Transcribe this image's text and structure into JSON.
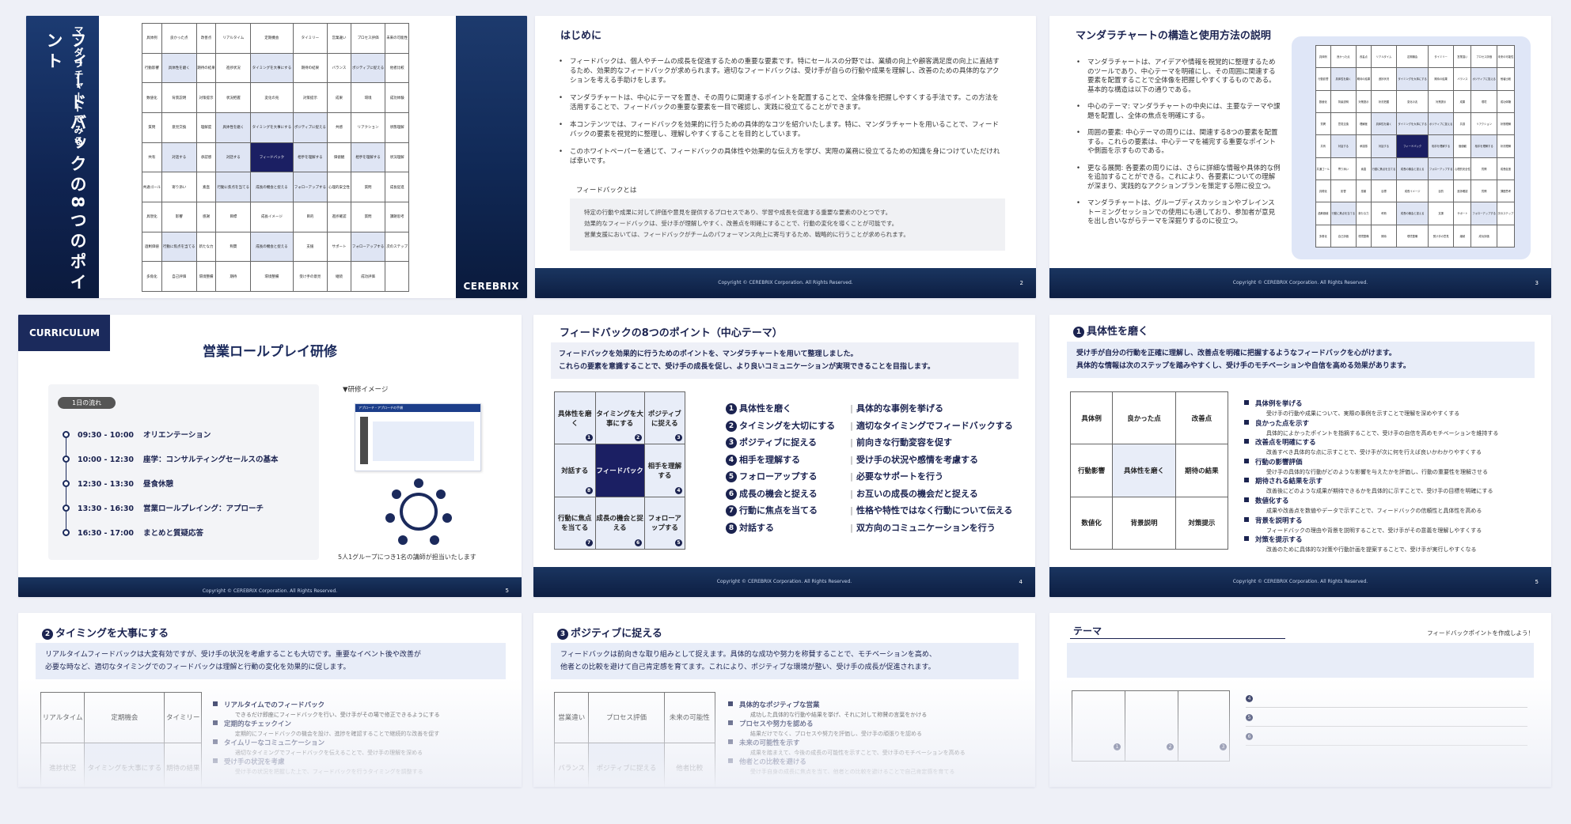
{
  "slide1": {
    "subtitle": "マンダラチャートでみる",
    "title": "フィードバックの8つのポイント",
    "logo": "CEREBRIX",
    "grid": [
      [
        "具体例",
        "良かった点",
        "改善点",
        "リアルタイム",
        "定期機会",
        "タイミリー",
        "営業違い",
        "プロセス評価",
        "未来の可能性"
      ],
      [
        "行動影響",
        "具体性を磨く",
        "期待の結果",
        "進捗状況",
        "タイミングを大事にする",
        "期待の結果",
        "バランス",
        "ポジティブに捉える",
        "他者比較"
      ],
      [
        "数値化",
        "背景説明",
        "対策提示",
        "状況把握",
        "変化の兆",
        "対策提示",
        "成果",
        "環境",
        "成功体験"
      ],
      [
        "質問",
        "意見交換",
        "理解度",
        "具体性を磨く",
        "タイミングを大事にする",
        "ポジティブに捉える",
        "共感",
        "リアクション",
        "状態理解"
      ],
      [
        "共有",
        "対話する",
        "承認感",
        "対話する",
        "フィードバック",
        "相手を理解する",
        "価値観",
        "相手を理解する",
        "状況理解"
      ],
      [
        "共通ゴール",
        "寄り添い",
        "素直",
        "行動に焦点を当てる",
        "成長の機会と捉える",
        "フォローアップする",
        "心理的安全性",
        "質問",
        "成長促進"
      ],
      [
        "具現化",
        "影響",
        "感謝",
        "目標",
        "成長イメージ",
        "目的",
        "進捗確認",
        "質問",
        "課題思考"
      ],
      [
        "過剰価値",
        "行動に焦点を当てる",
        "新たな力",
        "称賛",
        "成長の機会と捉える",
        "支援",
        "サポート",
        "フォローアップする",
        "次のステップ"
      ],
      [
        "多角化",
        "自己評価",
        "環境整備",
        "期待",
        "環境整備",
        "受け手の意見",
        "継続",
        "成功評価",
        ""
      ]
    ]
  },
  "slide2": {
    "title": "はじめに",
    "bullets": [
      "フィードバックは、個人やチームの成長を促進するための重要な要素です。特にセールスの分野では、業績の向上や顧客満足度の向上に直結するため、効果的なフィードバックが求められます。適切なフィードバックは、受け手が自らの行動や成果を理解し、改善のための具体的なアクションを考える手助けをします。",
      "マンダラチャートは、中心にテーマを置き、その周りに関連するポイントを配置することで、全体像を把握しやすくする手法です。この方法を活用することで、フィードバックの重要な要素を一目で確認し、実践に役立てることができます。",
      "本コンテンツでは、フィードバックを効果的に行うための具体的なコツを紹介いたします。特に、マンダラチャートを用いることで、フィードバックの要素を視覚的に整理し、理解しやすくすることを目的としています。",
      "このホワイトペーパーを通じて、フィードバックの具体性や効果的な伝え方を学び、実際の業務に役立てるための知識を身につけていただければ幸いです。"
    ],
    "box_heading": "フィードバックとは",
    "box_lines": [
      "特定の行動や成果に対して評価や意見を提供するプロセスであり、学習や成長を促進する重要な要素のひとつです。",
      "効果的なフィードバックは、受け手が理解しやすく、改善点を明確にすることで、行動の変化を導くことが可能です。",
      "営業支援においては、フィードバックがチームのパフォーマンス向上に寄与するため、戦略的に行うことが求められます。"
    ],
    "copyright": "Copyright © CEREBRIX Corporation. All Rights Reserved.",
    "page": "2"
  },
  "slide3": {
    "title": "マンダラチャートの構造と使用方法の説明",
    "bullets": [
      "マンダラチャートは、アイデアや情報を視覚的に整理するためのツールであり、中心テーマを明確にし、その周囲に関連する要素を配置することで全体像を把握しやすくするものである。基本的な構造は以下の通りである。",
      "中心のテーマ: マンダラチャートの中央には、主要なテーマや課題を配置し、全体の焦点を明確にする。",
      "周囲の要素: 中心テーマの周りには、関連する8つの要素を配置する。これらの要素は、中心テーマを補完する重要なポイントや側面を示すものである。",
      "更なる展開: 各要素の周りには、さらに詳細な情報や具体的な例を追加することができる。これにより、各要素についての理解が深まり、実践的なアクションプランを策定する際に役立つ。",
      "マンダラチャートは、グループディスカッションやブレインストーミングセッションでの使用にも適しており、参加者が意見を出し合いながらテーマを深掘りするのに役立つ。"
    ],
    "copyright": "Copyright © CEREBRIX Corporation. All Rights Reserved.",
    "page": "3"
  },
  "slide4": {
    "badge": "CURRICULUM",
    "title": "営業ロールプレイ研修",
    "flow_label": "1日の流れ",
    "schedule": [
      {
        "time": "09:30 - 10:00",
        "item": "オリエンテーション"
      },
      {
        "time": "10:00 - 12:30",
        "item": "座学：コンサルティングセールスの基本"
      },
      {
        "time": "12:30 - 13:30",
        "item": "昼食休憩"
      },
      {
        "time": "13:30 - 16:30",
        "item": "営業ロールプレイング：アプローチ"
      },
      {
        "time": "16:30 - 17:00",
        "item": "まとめと質疑応答"
      }
    ],
    "image_label": "▼研修イメージ",
    "image_caption": "アプローチ・アプローチの手順",
    "group_note": "5人1グループにつき1名の講師が担当いたします",
    "copyright": "Copyright © CEREBRIX Corporation. All Rights Reserved.",
    "page": "5"
  },
  "slide5": {
    "title": "フィードバックの8つのポイント（中心テーマ）",
    "intro": [
      "フィードバックを効果的に行うためのポイントを、マンダラチャートを用いて整理しました。",
      "これらの要素を意識することで、受け手の成長を促し、より良いコミュニケーションが実現できることを目指します。"
    ],
    "grid": [
      [
        {
          "t": "具体性を磨く",
          "n": "1"
        },
        {
          "t": "タイミングを大事にする",
          "n": "2"
        },
        {
          "t": "ポジティブに捉える",
          "n": "3"
        }
      ],
      [
        {
          "t": "対話する",
          "n": "8"
        },
        {
          "t": "フィードバック",
          "n": ""
        },
        {
          "t": "相手を理解する",
          "n": "4"
        }
      ],
      [
        {
          "t": "行動に焦点を当てる",
          "n": "7"
        },
        {
          "t": "成長の機会と捉える",
          "n": "6"
        },
        {
          "t": "フォローアップする",
          "n": "5"
        }
      ]
    ],
    "points": [
      {
        "n": "1",
        "name": "具体性を磨く",
        "desc": "具体的な事例を挙げる"
      },
      {
        "n": "2",
        "name": "タイミングを大切にする",
        "desc": "適切なタイミングでフィードバックする"
      },
      {
        "n": "3",
        "name": "ポジティブに捉える",
        "desc": "前向きな行動変容を促す"
      },
      {
        "n": "4",
        "name": "相手を理解する",
        "desc": "受け手の状況や感情を考慮する"
      },
      {
        "n": "5",
        "name": "フォローアップする",
        "desc": "必要なサポートを行う"
      },
      {
        "n": "6",
        "name": "成長の機会と捉える",
        "desc": "お互いの成長の機会だと捉える"
      },
      {
        "n": "7",
        "name": "行動に焦点を当てる",
        "desc": "性格や特性ではなく行動について伝える"
      },
      {
        "n": "8",
        "name": "対話する",
        "desc": "双方向のコミュニケーションを行う"
      }
    ],
    "copyright": "Copyright © CEREBRIX Corporation. All Rights Reserved.",
    "page": "4"
  },
  "slide6": {
    "title": "具体性を磨く",
    "num": "1",
    "intro": [
      "受け手が自分の行動を正確に理解し、改善点を明確に把握するようなフィードバックを心がけます。",
      "具体的な情報は次のステップを踏みやすくし、受け手のモチベーションや自信を高める効果があります。"
    ],
    "grid": [
      [
        "具体例",
        "良かった点",
        "改善点"
      ],
      [
        "行動影響",
        "具体性を磨く",
        "期待の結果"
      ],
      [
        "数値化",
        "背景説明",
        "対策提示"
      ]
    ],
    "items": [
      {
        "h": "具体例を挙げる",
        "d": "受け手の行動や成果について、実際の事例を示すことで理解を深めやすくする"
      },
      {
        "h": "良かった点を示す",
        "d": "具体的によかったポイントを指摘することで、受け手の自信を高めモチベーションを維持する"
      },
      {
        "h": "改善点を明確にする",
        "d": "改善すべき具体的な点に示すことで、受け手が次に何を行えば良いかわかりやすくする"
      },
      {
        "h": "行動の影響評価",
        "d": "受け手の具体的な行動がどのような影響を与えたかを評価し、行動の重要性を理解させる"
      },
      {
        "h": "期待される結果を示す",
        "d": "改善後にどのような成果が期待できるかを具体的に示すことで、受け手の目標を明確にする"
      },
      {
        "h": "数値化する",
        "d": "成果や改善点を数値やデータで示すことで、フィードバックの信頼性と具体性を高める"
      },
      {
        "h": "背景を説明する",
        "d": "フィードバックの理由や背景を説明することで、受け手がその意義を理解しやすくする"
      },
      {
        "h": "対策を提示する",
        "d": "改善のために具体的な対策や行動計画を提案することで、受け手が実行しやすくなる"
      }
    ],
    "copyright": "Copyright © CEREBRIX Corporation. All Rights Reserved.",
    "page": "5"
  },
  "slide7": {
    "title": "タイミングを大事にする",
    "num": "2",
    "intro": [
      "リアルタイムフィードバックは大変有効ですが、受け手の状況を考慮することも大切です。重要なイベント後や改善が",
      "必要な時など、適切なタイミングでのフィードバックは理解と行動の変化を効果的に促します。"
    ],
    "grid": [
      [
        "リアルタイム",
        "定期機会",
        "タイミリー"
      ],
      [
        "進捗状況",
        "タイミングを大事にする",
        "期待の結果"
      ]
    ],
    "items": [
      {
        "h": "リアルタイムでのフィードバック",
        "d": "できるだけ即座にフィードバックを行い、受け手がその場で修正できるようにする"
      },
      {
        "h": "定期的なチェックイン",
        "d": "定期的にフィードバックの機会を設け、進捗を確認することで継続的な改善を促す"
      },
      {
        "h": "タイムリーなコミュニケーション",
        "d": "適切なタイミングでフィードバックを伝えることで、受け手の理解を深める"
      },
      {
        "h": "受け手の状況を考慮",
        "d": "受け手の状況を把握した上で、フィードバックを行うタイミングを調整する"
      }
    ]
  },
  "slide8": {
    "title": "ポジティブに捉える",
    "num": "3",
    "intro": [
      "フィードバックは前向きな取り組みとして捉えます。具体的な成功や努力を称賛することで、モチベーションを高め、",
      "他者との比較を避けて自己肯定感を育てます。これにより、ポジティブな環境が整い、受け手の成長が促進されます。"
    ],
    "grid": [
      [
        "営業違い",
        "プロセス評価",
        "未来の可能性"
      ],
      [
        "バランス",
        "ポジティブに捉える",
        "他者比較"
      ]
    ],
    "items": [
      {
        "h": "具体的なポジティブな営業",
        "d": "成功した具体的な行動や結果を挙げ、それに対して称賛の言葉をかける"
      },
      {
        "h": "プロセスや努力を認める",
        "d": "結果だけでなく、プロセスや努力を評価し、受け手の頑張りを認める"
      },
      {
        "h": "未来の可能性を示す",
        "d": "成果を踏まえて、今後の成長の可能性を示すことで、受け手のモチベーションを高める"
      },
      {
        "h": "他者との比較を避ける",
        "d": "受け手自身の成長に焦点を当て、他者との比較を避けることで自己肯定感を育てる"
      }
    ]
  },
  "slide9": {
    "title": "テーマ",
    "tag": "フィードバックポイントを作成しよう！",
    "nums": [
      "1",
      "2",
      "3",
      "4",
      "5",
      "6"
    ]
  }
}
